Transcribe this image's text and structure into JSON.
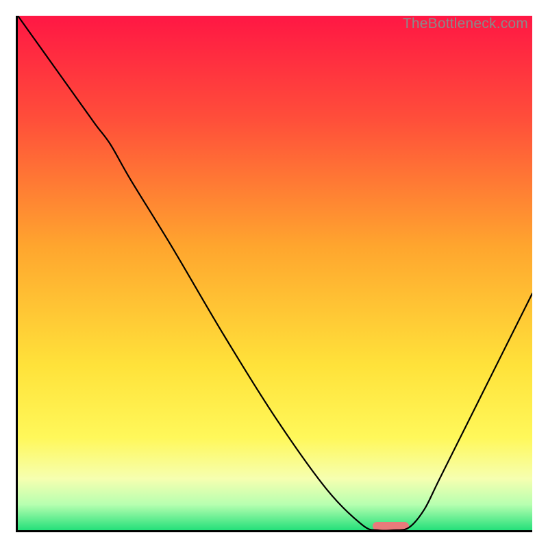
{
  "watermark": "TheBottleneck.com",
  "chart_data": {
    "type": "line",
    "title": "",
    "xlabel": "",
    "ylabel": "",
    "xlim": [
      0,
      100
    ],
    "ylim": [
      0,
      100
    ],
    "grid": false,
    "series": [
      {
        "name": "bottleneck-curve",
        "x": [
          0,
          5,
          10,
          15,
          18,
          22,
          30,
          40,
          50,
          60,
          67,
          70,
          73,
          76,
          79,
          82,
          90,
          100
        ],
        "values": [
          100,
          93,
          86,
          79,
          75,
          68,
          55,
          38,
          22,
          8,
          1,
          0,
          0,
          0.5,
          4,
          10,
          26,
          46
        ]
      }
    ],
    "marker": {
      "x_start": 69,
      "x_end": 76,
      "y": 0
    },
    "gradient_stops": [
      {
        "pct": 0,
        "color": "#ff1744"
      },
      {
        "pct": 20,
        "color": "#ff4e3a"
      },
      {
        "pct": 45,
        "color": "#ffa62e"
      },
      {
        "pct": 68,
        "color": "#ffe23a"
      },
      {
        "pct": 82,
        "color": "#fff85a"
      },
      {
        "pct": 90,
        "color": "#f6ffb0"
      },
      {
        "pct": 95,
        "color": "#b7ffb0"
      },
      {
        "pct": 100,
        "color": "#24e07a"
      }
    ]
  }
}
